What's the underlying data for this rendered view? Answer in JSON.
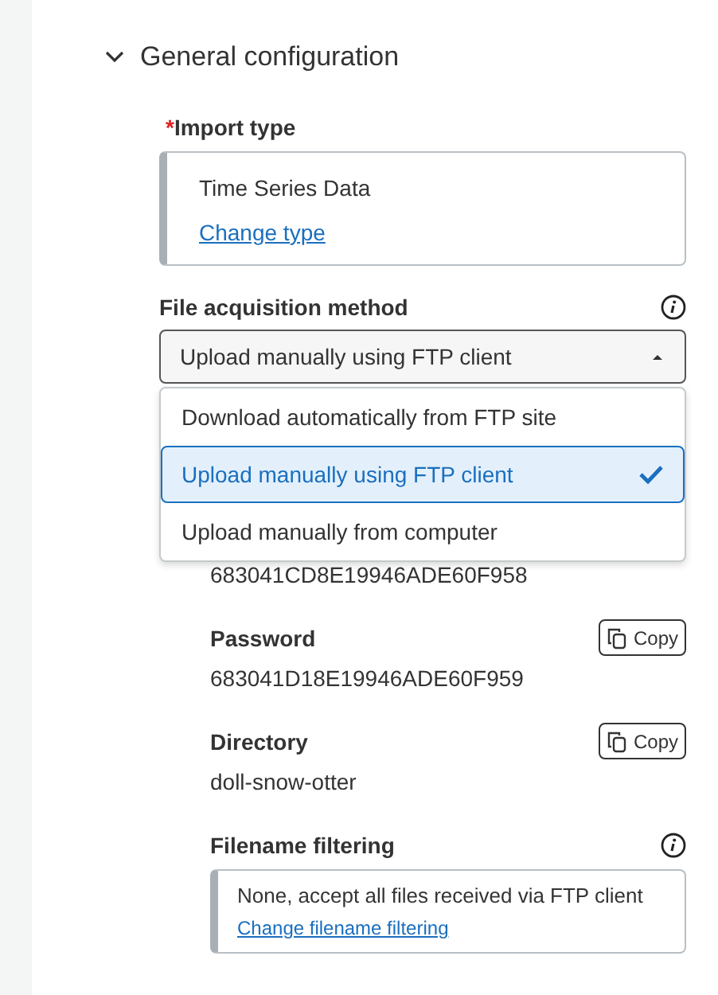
{
  "section": {
    "title": "General configuration",
    "expanded": true
  },
  "import_type": {
    "label": "Import type",
    "required_mark": "*",
    "value": "Time Series Data",
    "link": "Change type"
  },
  "acquisition": {
    "label": "File acquisition method",
    "value": "Upload manually using FTP client",
    "open": true,
    "options": [
      {
        "label": "Download automatically from FTP site",
        "selected": false
      },
      {
        "label": "Upload manually using FTP client",
        "selected": true
      },
      {
        "label": "Upload manually from computer",
        "selected": false
      }
    ]
  },
  "credentials": [
    {
      "value": "683041CD8E19946ADE60F958"
    },
    {
      "label": "Password",
      "value": "683041D18E19946ADE60F959",
      "copy": "Copy"
    },
    {
      "label": "Directory",
      "value": "doll-snow-otter",
      "copy": "Copy"
    }
  ],
  "filtering": {
    "label": "Filename filtering",
    "value": "None, accept all files received via FTP client",
    "link": "Change filename filtering"
  }
}
